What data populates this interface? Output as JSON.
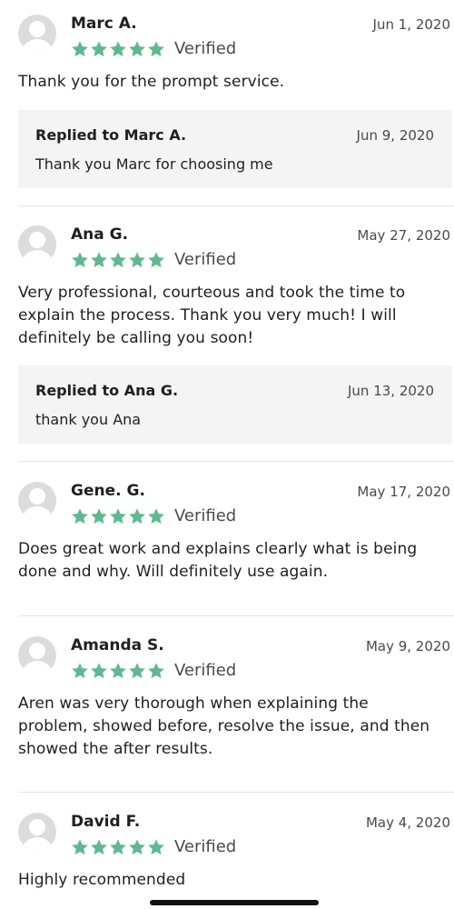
{
  "accent_color": "#5fb98f",
  "reviews": [
    {
      "name": "Marc A.",
      "date": "Jun 1, 2020",
      "rating": 5,
      "verified_label": "Verified",
      "text": "Thank you for the prompt service.",
      "reply": {
        "title": "Replied to Marc A.",
        "date": "Jun 9, 2020",
        "text": "Thank you Marc for choosing me"
      }
    },
    {
      "name": "Ana G.",
      "date": "May 27, 2020",
      "rating": 5,
      "verified_label": "Verified",
      "text_lines": [
        "Very professional, courteous and took the time to",
        "explain the process. Thank you very much! I will",
        "definitely be calling you soon!"
      ],
      "reply": {
        "title": "Replied to Ana G.",
        "date": "Jun 13, 2020",
        "text": "thank you Ana"
      }
    },
    {
      "name": "Gene. G.",
      "date": "May 17, 2020",
      "rating": 5,
      "verified_label": "Verified",
      "text_lines": [
        "Does great work and explains clearly what is being",
        "done and why. Will definitely use again."
      ]
    },
    {
      "name": "Amanda S.",
      "date": "May 9, 2020",
      "rating": 5,
      "verified_label": "Verified",
      "text_lines": [
        "Aren was very thorough when explaining the",
        "problem, showed before, resolve the issue, and then",
        "showed the after results."
      ]
    },
    {
      "name": "David F.",
      "date": "May 4, 2020",
      "rating": 5,
      "verified_label": "Verified",
      "text": "Highly recommended"
    }
  ]
}
